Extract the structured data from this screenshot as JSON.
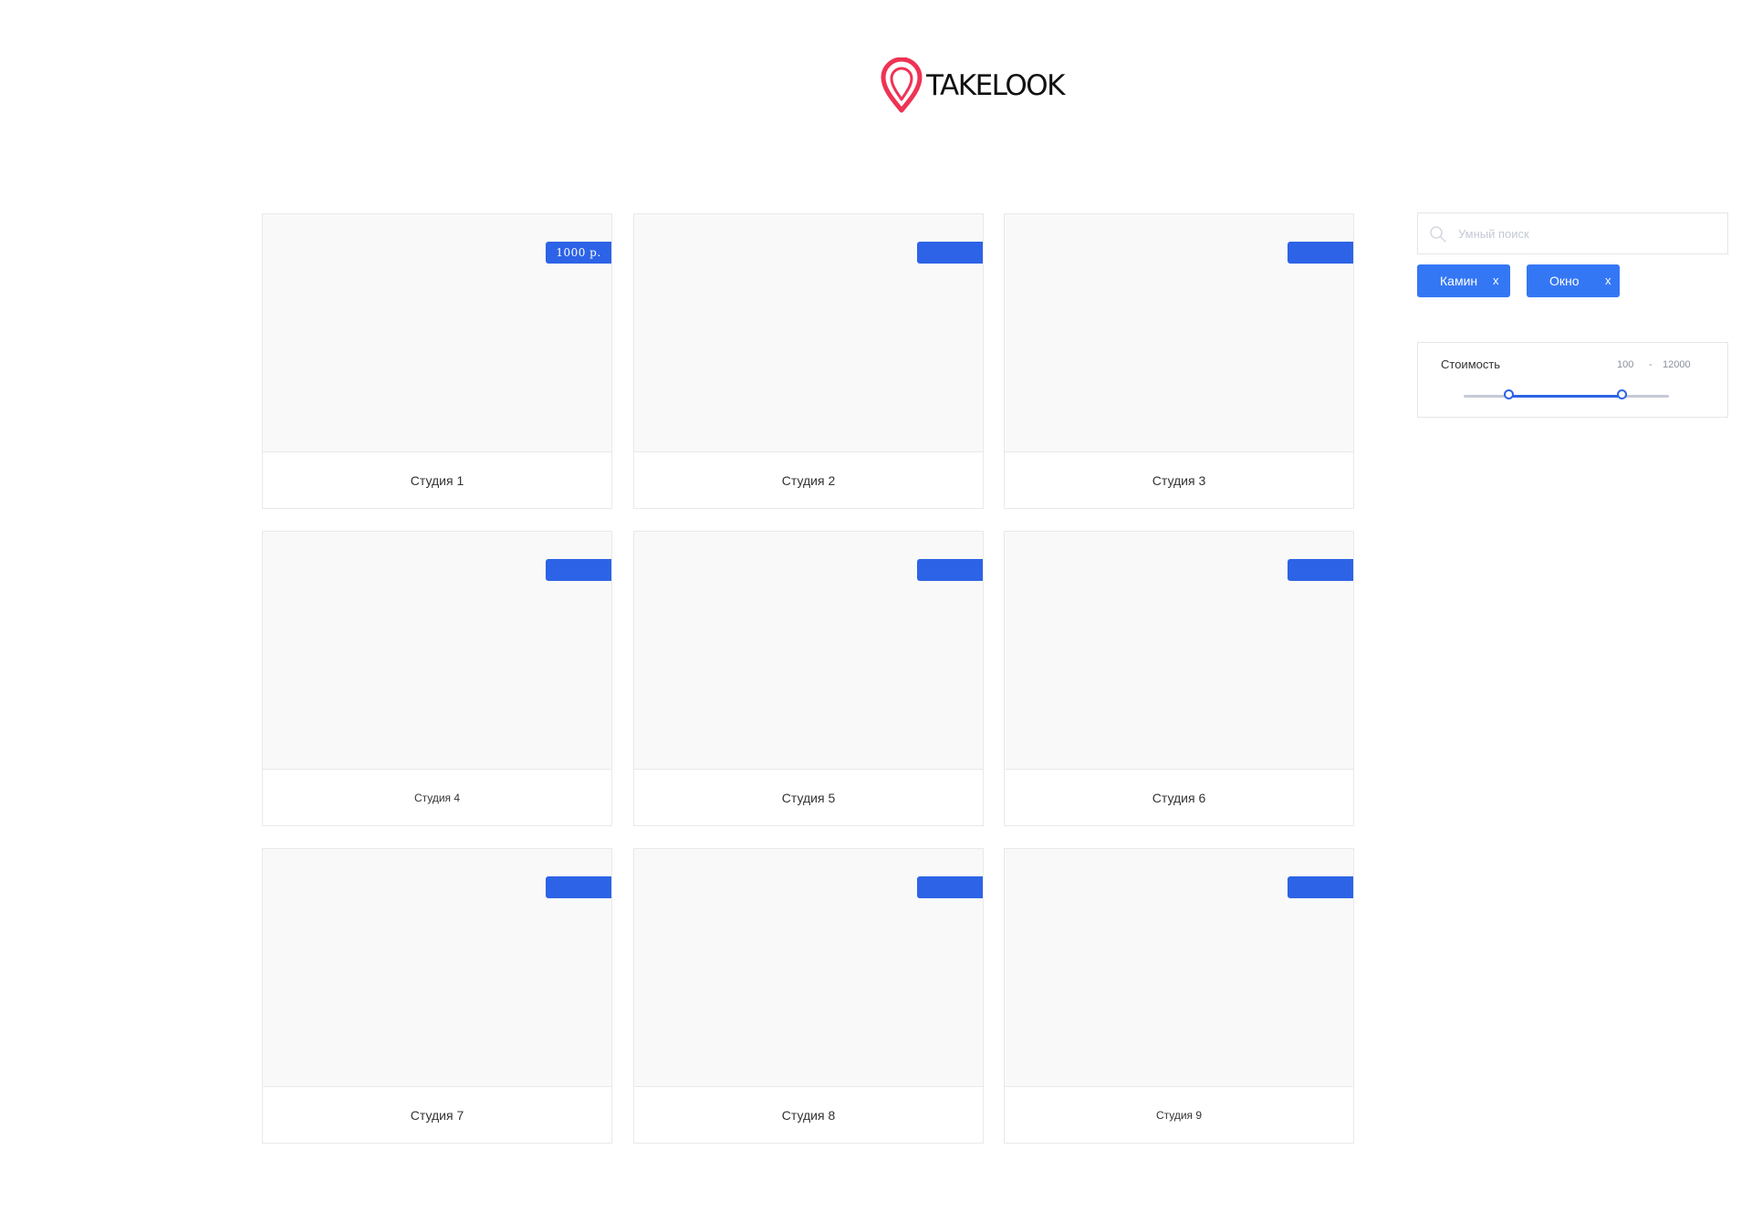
{
  "logo": {
    "text": "TAKELOOK",
    "accent_color": "#ef3355",
    "icon": "location-pin-icon"
  },
  "cards": [
    {
      "title": "Студия 1",
      "price": "1000 р."
    },
    {
      "title": "Студия 2",
      "price": ""
    },
    {
      "title": "Студия 3",
      "price": ""
    },
    {
      "title": "Студия 4",
      "price": ""
    },
    {
      "title": "Студия 5",
      "price": ""
    },
    {
      "title": "Студия 6",
      "price": ""
    },
    {
      "title": "Студия 7",
      "price": ""
    },
    {
      "title": "Студия 8",
      "price": ""
    },
    {
      "title": "Студия 9",
      "price": ""
    }
  ],
  "search": {
    "placeholder": "Умный поиск",
    "value": "",
    "icon": "search-icon"
  },
  "filters": {
    "chips": [
      {
        "label": "Камин",
        "close": "x"
      },
      {
        "label": "Окно",
        "close": "x"
      }
    ]
  },
  "price_filter": {
    "label": "Стоимость",
    "min": "100",
    "separator": "-",
    "max": "12000",
    "range_fraction": [
      0.22,
      0.77
    ]
  },
  "colors": {
    "tag": "#2d63e6",
    "chip": "#3477f5",
    "slider_fill": "#2d63e6",
    "slider_track": "#c6cad6"
  }
}
